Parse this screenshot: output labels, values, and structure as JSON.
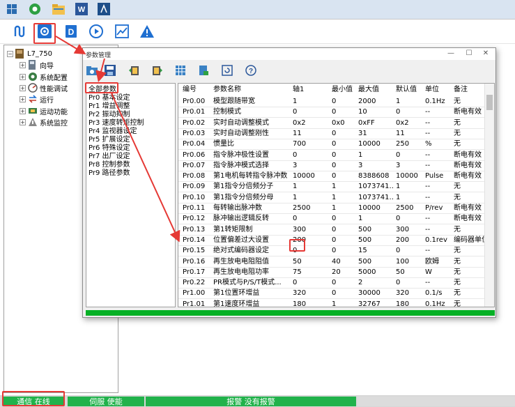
{
  "taskbar": {
    "icons": [
      "windows-icon",
      "browser-icon",
      "file-explorer-icon",
      "word-icon",
      "drive-app-icon"
    ]
  },
  "toolbar": {
    "icons": [
      "connect-icon",
      "parameter-settings-icon",
      "drive-icon",
      "run-icon",
      "monitor-chart-icon",
      "alarm-warning-icon"
    ]
  },
  "tree": {
    "root": "L7_750",
    "children": [
      "向导",
      "系统配置",
      "性能调试",
      "运行",
      "运动功能",
      "系统监控"
    ]
  },
  "dialog": {
    "title": "参数管理",
    "controls": {
      "minimize": "—",
      "maximize": "☐",
      "close": "✕"
    },
    "tool_icons": [
      "open-icon",
      "save-icon",
      "upload-icon",
      "download-icon",
      "grid-icon",
      "import-icon",
      "reset-icon",
      "help-icon"
    ],
    "groups": [
      "全部参数",
      "Pr0 基本设定",
      "Pr1 增益调整",
      "Pr2 振动抑制",
      "Pr3 速度转矩控制",
      "Pr4 监视器设定",
      "Pr5 扩展设定",
      "Pr6 特殊设定",
      "Pr7 出厂设定",
      "Pr8 控制参数",
      "Pr9 路径参数"
    ],
    "table": {
      "headers": [
        "编号",
        "参数名称",
        "轴1",
        "最小值",
        "最大值",
        "默认值",
        "单位",
        "备注"
      ],
      "rows": [
        [
          "Pr0.00",
          "模型跟随带宽",
          "1",
          "0",
          "2000",
          "1",
          "0.1Hz",
          "无"
        ],
        [
          "Pr0.01",
          "控制模式",
          "0",
          "0",
          "10",
          "0",
          "--",
          "断电有效"
        ],
        [
          "Pr0.02",
          "实时自动调整模式",
          "0x2",
          "0x0",
          "0xFF",
          "0x2",
          "--",
          "无"
        ],
        [
          "Pr0.03",
          "实时自动调整刚性",
          "11",
          "0",
          "31",
          "11",
          "--",
          "无"
        ],
        [
          "Pr0.04",
          "惯量比",
          "700",
          "0",
          "10000",
          "250",
          "%",
          "无"
        ],
        [
          "Pr0.06",
          "指令脉冲极性设置",
          "0",
          "0",
          "1",
          "0",
          "--",
          "断电有效"
        ],
        [
          "Pr0.07",
          "指令脉冲模式选择",
          "3",
          "0",
          "3",
          "3",
          "--",
          "断电有效"
        ],
        [
          "Pr0.08",
          "第1电机每转指令脉冲数",
          "10000",
          "0",
          "8388608",
          "10000",
          "Pulse",
          "断电有效"
        ],
        [
          "Pr0.09",
          "第1指令分倍频分子",
          "1",
          "1",
          "1073741...",
          "1",
          "--",
          "无"
        ],
        [
          "Pr0.10",
          "第1指令分倍频分母",
          "1",
          "1",
          "1073741...",
          "1",
          "--",
          "无"
        ],
        [
          "Pr0.11",
          "每转输出脉冲数",
          "2500",
          "1",
          "10000",
          "2500",
          "P/rev",
          "断电有效"
        ],
        [
          "Pr0.12",
          "脉冲输出逻辑反转",
          "0",
          "0",
          "1",
          "0",
          "--",
          "断电有效"
        ],
        [
          "Pr0.13",
          "第1转矩限制",
          "300",
          "0",
          "500",
          "300",
          "--",
          "无"
        ],
        [
          "Pr0.14",
          "位置偏差过大设置",
          "200",
          "0",
          "500",
          "200",
          "0.1rev",
          "编码器单位"
        ],
        [
          "Pr0.15",
          "绝对式编码器设定",
          "0",
          "0",
          "15",
          "0",
          "--",
          "无"
        ],
        [
          "Pr0.16",
          "再生放电电阻阻值",
          "50",
          "40",
          "500",
          "100",
          "欧姆",
          "无"
        ],
        [
          "Pr0.17",
          "再生放电电阻功率",
          "75",
          "20",
          "5000",
          "50",
          "W",
          "无"
        ],
        [
          "Pr0.22",
          "PR模式与P/S/T模式...",
          "0",
          "0",
          "2",
          "0",
          "--",
          "无"
        ],
        [
          "Pr1.00",
          "第1位置环增益",
          "320",
          "0",
          "30000",
          "320",
          "0.1/s",
          "无"
        ],
        [
          "Pr1.01",
          "第1速度环增益",
          "180",
          "1",
          "32767",
          "180",
          "0.1Hz",
          "无"
        ]
      ]
    },
    "progress": 1.0
  },
  "status": {
    "comm": "通信 在线",
    "servo": "伺服 使能",
    "alarm": "报警 没有报警"
  },
  "colors": {
    "status_green": "#21b24b",
    "progress_green": "#06b025",
    "annotation_red": "#e53935"
  }
}
